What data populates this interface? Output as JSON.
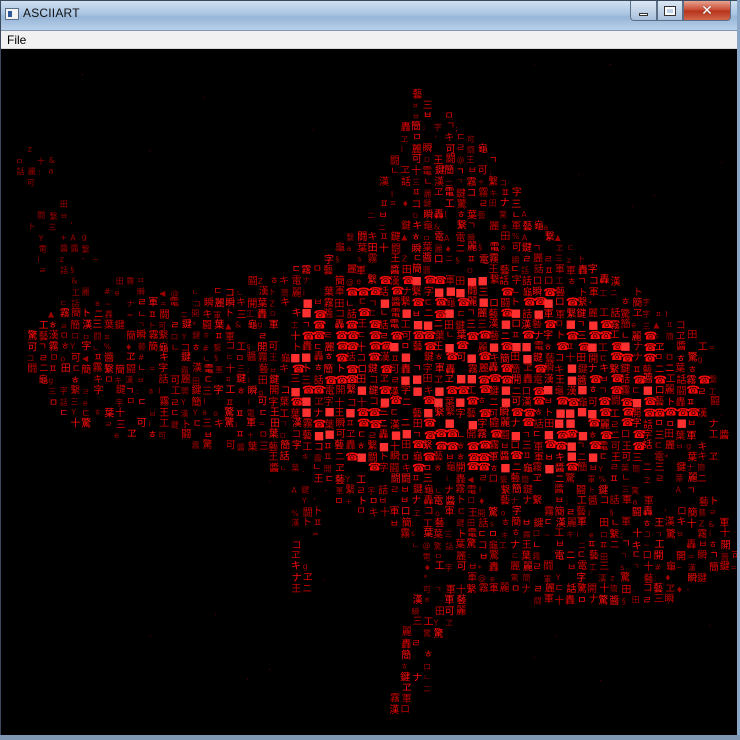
{
  "window": {
    "title": "ASCIIART",
    "close_glyph": "✕"
  },
  "menu": {
    "items": [
      "File"
    ]
  },
  "art": {
    "background_color": "#000000",
    "glyph_colors": [
      "#e10000",
      "#c40000",
      "#ff0a0a",
      "#9e0000",
      "#ff3030",
      "#b00808"
    ],
    "glyph_pool": [
      "鍵",
      "醬",
      "麗",
      "簡",
      "闘",
      "轟",
      "繋",
      "藝",
      "驚",
      "瞬",
      "龜",
      "葉",
      "軍",
      "開",
      "霧",
      "電",
      "話",
      "漢",
      "字",
      "ㄹ",
      "ㅁ",
      "ㅂ",
      "ㅍ",
      "ㄷ",
      "ㅎ",
      "ㄱ",
      "ㄴ",
      "コ",
      "ニ",
      "ト",
      "ナ",
      "キ",
      "ロ",
      "ヱ",
      "可",
      "十",
      "工",
      "三",
      "王",
      "田",
      "▲",
      "◀",
      "♦",
      "§",
      "¤",
      "#",
      "@",
      "%",
      "&",
      "=",
      "+",
      "*",
      "-",
      "~",
      ";",
      ":",
      ".",
      "'",
      "e",
      "z",
      "Z",
      "o",
      "A",
      "Y",
      "I",
      "i",
      "g",
      "s",
      "a"
    ],
    "telephone_glyph": "☎",
    "block_glyph": "■"
  }
}
